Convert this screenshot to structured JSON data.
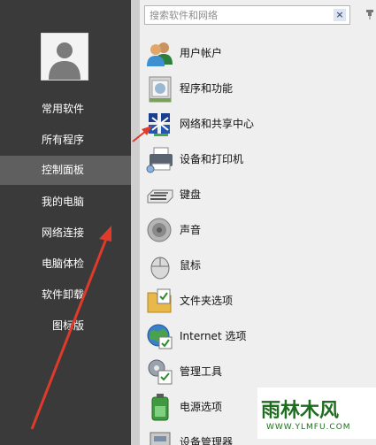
{
  "sidebar": {
    "items": [
      {
        "label": "常用软件",
        "active": false
      },
      {
        "label": "所有程序",
        "active": false
      },
      {
        "label": "控制面板",
        "active": true
      },
      {
        "label": "我的电脑",
        "active": false
      },
      {
        "label": "网络连接",
        "active": false
      },
      {
        "label": "电脑体检",
        "active": false
      },
      {
        "label": "软件卸载",
        "active": false
      },
      {
        "label": "图标版",
        "active": false
      }
    ]
  },
  "search": {
    "placeholder": "搜索软件和网络",
    "clear_label": "×"
  },
  "control_panel": {
    "items": [
      {
        "label": "用户帐户",
        "icon": "user-accounts-icon"
      },
      {
        "label": "程序和功能",
        "icon": "programs-features-icon"
      },
      {
        "label": "网络和共享中心",
        "icon": "network-sharing-icon"
      },
      {
        "label": "设备和打印机",
        "icon": "devices-printers-icon"
      },
      {
        "label": "键盘",
        "icon": "keyboard-icon"
      },
      {
        "label": "声音",
        "icon": "sound-icon"
      },
      {
        "label": "鼠标",
        "icon": "mouse-icon"
      },
      {
        "label": "文件夹选项",
        "icon": "folder-options-icon"
      },
      {
        "label": "Internet 选项",
        "icon": "internet-options-icon"
      },
      {
        "label": "管理工具",
        "icon": "admin-tools-icon"
      },
      {
        "label": "电源选项",
        "icon": "power-options-icon"
      },
      {
        "label": "设备管理器",
        "icon": "device-manager-icon"
      }
    ]
  },
  "watermark": {
    "text": "雨林木风",
    "url": "WWW.YLMFU.COM"
  },
  "colors": {
    "sidebar_bg": "#3a3a3a",
    "sidebar_active": "#5f5f5f",
    "panel_bg": "#efefef",
    "annotation_arrow": "#e03a2a"
  }
}
